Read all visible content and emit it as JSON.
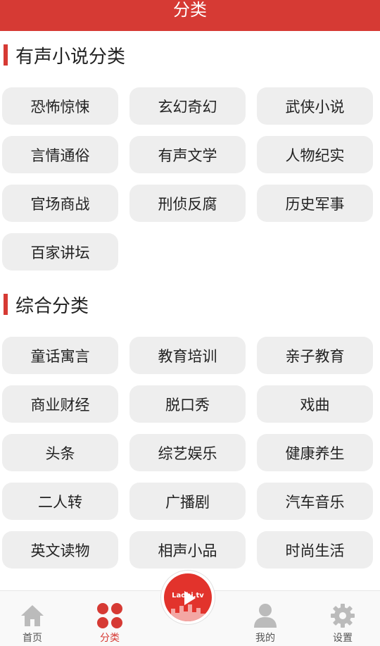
{
  "header": {
    "title": "分类"
  },
  "sections": [
    {
      "title": "有声小说分类",
      "items": [
        "恐怖惊悚",
        "玄幻奇幻",
        "武侠小说",
        "言情通俗",
        "有声文学",
        "人物纪实",
        "官场商战",
        "刑侦反腐",
        "历史军事",
        "百家讲坛"
      ]
    },
    {
      "title": "综合分类",
      "items": [
        "童话寓言",
        "教育培训",
        "亲子教育",
        "商业财经",
        "脱口秀",
        "戏曲",
        "头条",
        "综艺娱乐",
        "健康养生",
        "二人转",
        "广播剧",
        "汽车音乐",
        "英文读物",
        "相声小品",
        "时尚生活"
      ]
    }
  ],
  "tabbar": {
    "home": "首页",
    "category": "分类",
    "center_brand": "Laohi.tv",
    "mine": "我的",
    "settings": "设置"
  },
  "colors": {
    "accent": "#d63a34",
    "chip_bg": "#eeeeee",
    "tab_inactive": "#bbbbbb"
  },
  "icons": {
    "home": "home-icon",
    "category": "category-grid-icon",
    "center": "play-icon",
    "mine": "user-icon",
    "settings": "gear-icon"
  }
}
